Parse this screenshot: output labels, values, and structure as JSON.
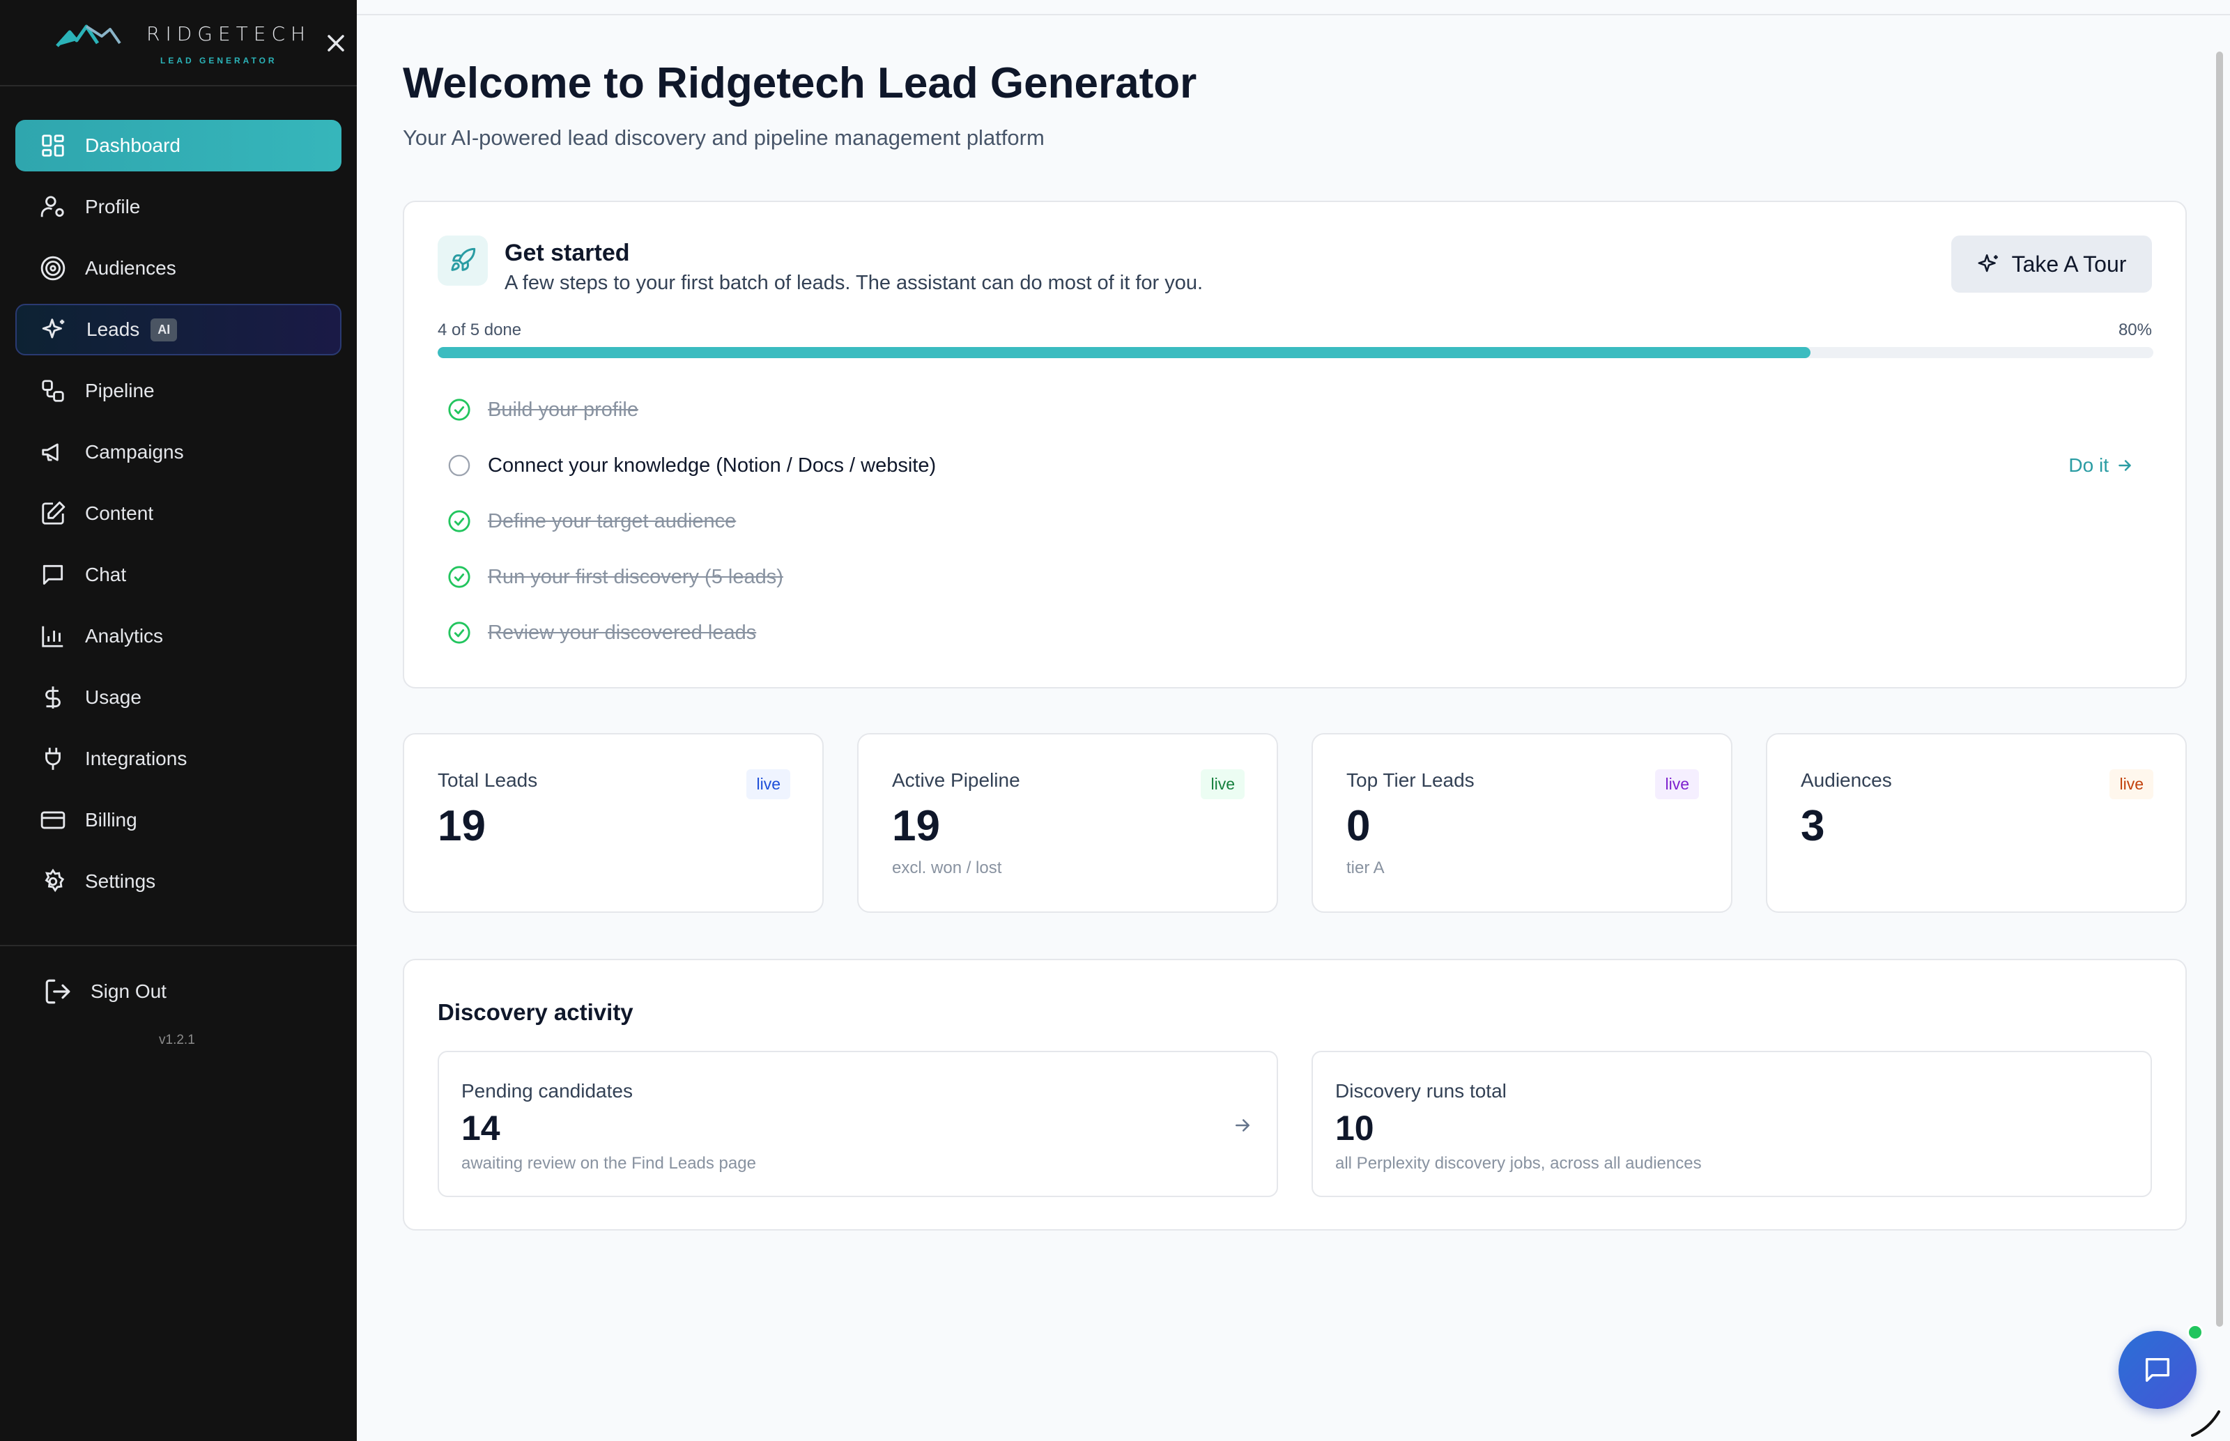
{
  "brand": {
    "name": "RIDGETECH",
    "tagline": "LEAD GENERATOR"
  },
  "sidebar": {
    "items": [
      {
        "label": "Dashboard",
        "icon": "dashboard-grid-icon"
      },
      {
        "label": "Profile",
        "icon": "user-gear-icon"
      },
      {
        "label": "Audiences",
        "icon": "target-icon"
      },
      {
        "label": "Leads",
        "icon": "sparkles-icon",
        "badge": "AI"
      },
      {
        "label": "Pipeline",
        "icon": "workflow-icon"
      },
      {
        "label": "Campaigns",
        "icon": "megaphone-icon"
      },
      {
        "label": "Content",
        "icon": "edit-square-icon"
      },
      {
        "label": "Chat",
        "icon": "chat-bubble-icon"
      },
      {
        "label": "Analytics",
        "icon": "bar-chart-icon"
      },
      {
        "label": "Usage",
        "icon": "dollar-icon"
      },
      {
        "label": "Integrations",
        "icon": "plug-icon"
      },
      {
        "label": "Billing",
        "icon": "credit-card-icon"
      },
      {
        "label": "Settings",
        "icon": "gear-icon"
      }
    ],
    "active_item": "Dashboard",
    "signout_label": "Sign Out",
    "version": "v1.2.1"
  },
  "main": {
    "title": "Welcome to Ridgetech Lead Generator",
    "subtitle": "Your AI-powered lead discovery and pipeline management platform"
  },
  "get_started": {
    "title": "Get started",
    "description": "A few steps to your first batch of leads. The assistant can do most of it for you.",
    "tour_button": "Take A Tour",
    "progress_label": "4 of 5 done",
    "progress_percent_text": "80%",
    "progress_fraction": 0.8,
    "steps": [
      {
        "label": "Build your profile",
        "done": true
      },
      {
        "label": "Connect your knowledge (Notion / Docs / website)",
        "done": false,
        "action": "Do it"
      },
      {
        "label": "Define your target audience",
        "done": true
      },
      {
        "label": "Run your first discovery (5 leads)",
        "done": true
      },
      {
        "label": "Review your discovered leads",
        "done": true
      }
    ]
  },
  "stats": [
    {
      "label": "Total Leads",
      "value": "19",
      "sub": "",
      "badge": "live",
      "badge_color": "#1d4ed8",
      "badge_bg": "#eff4ff"
    },
    {
      "label": "Active Pipeline",
      "value": "19",
      "sub": "excl. won / lost",
      "badge": "live",
      "badge_color": "#15803d",
      "badge_bg": "#ecfdf3"
    },
    {
      "label": "Top Tier Leads",
      "value": "0",
      "sub": "tier A",
      "badge": "live",
      "badge_color": "#7e22ce",
      "badge_bg": "#f5efff"
    },
    {
      "label": "Audiences",
      "value": "3",
      "sub": "",
      "badge": "live",
      "badge_color": "#c2410c",
      "badge_bg": "#fff7ed"
    }
  ],
  "discovery": {
    "title": "Discovery activity",
    "cards": [
      {
        "label": "Pending candidates",
        "value": "14",
        "sub": "awaiting review on the Find Leads page"
      },
      {
        "label": "Discovery runs total",
        "value": "10",
        "sub": "all Perplexity discovery jobs, across all audiences"
      }
    ]
  },
  "colors": {
    "accent": "#36b6bb",
    "sidebar_bg": "#121212",
    "link": "#2a9ca3",
    "check_green": "#22c55e"
  }
}
